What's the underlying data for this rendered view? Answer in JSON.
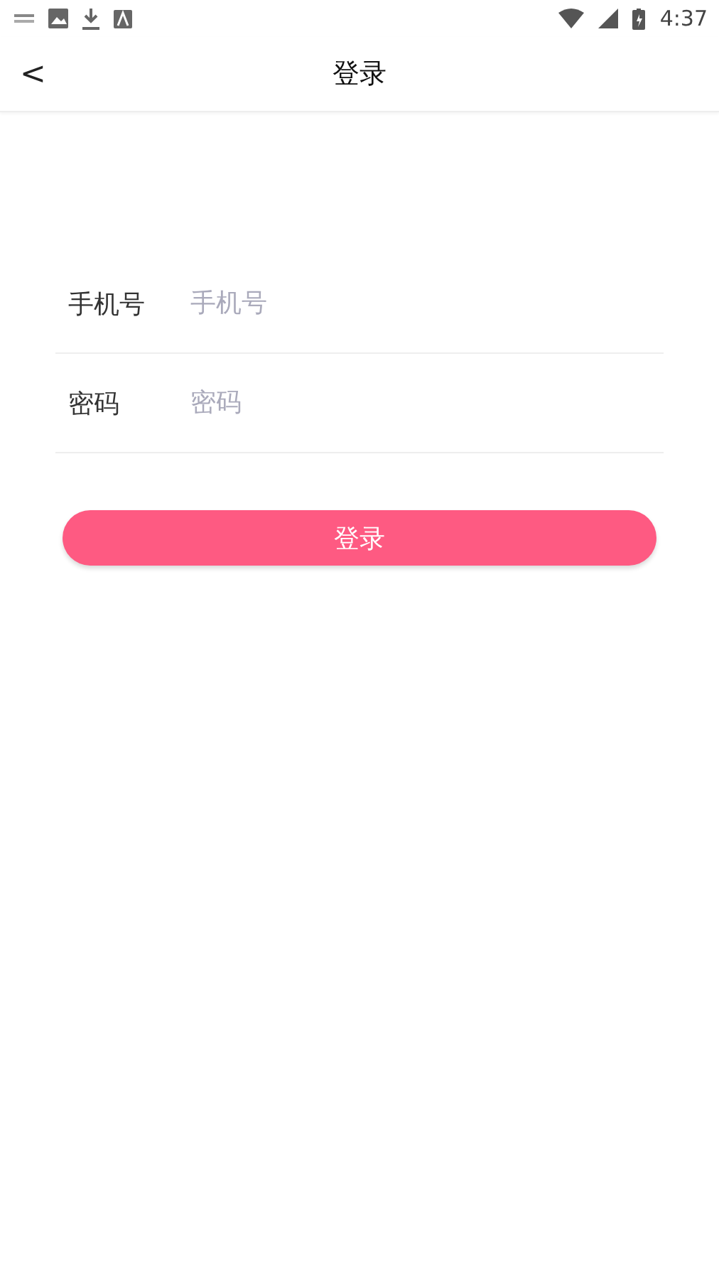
{
  "status_bar": {
    "time": "4:37"
  },
  "header": {
    "back": "<",
    "title": "登录"
  },
  "fields": [
    {
      "label": "手机号",
      "placeholder": "手机号"
    },
    {
      "label": "密码",
      "placeholder": "密码"
    }
  ],
  "button": "登录"
}
